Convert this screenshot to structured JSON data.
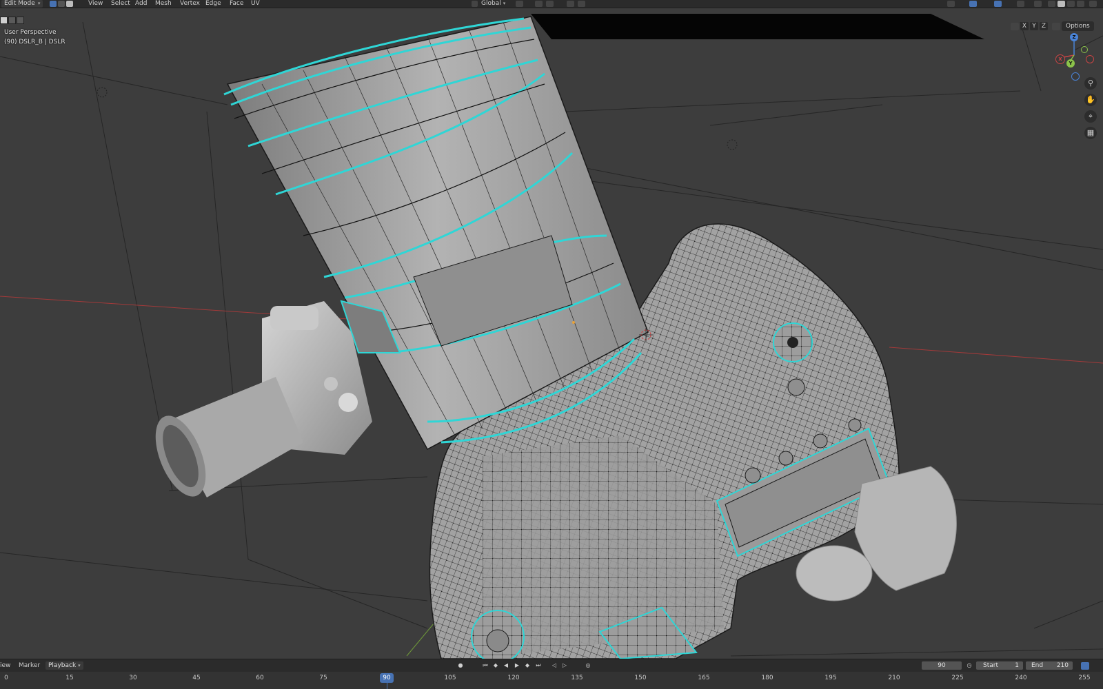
{
  "header": {
    "mode": "Edit Mode",
    "menus": [
      "View",
      "Select",
      "Add",
      "Mesh",
      "Vertex",
      "Edge",
      "Face",
      "UV"
    ],
    "transform_orientation": "Global",
    "axis_buttons": [
      "X",
      "Y",
      "Z"
    ],
    "options_label": "Options"
  },
  "viewport": {
    "view_name": "User Perspective",
    "object_info": "(90) DSLR_B | DSLR",
    "gizmo_axes": [
      "X",
      "Y",
      "Z"
    ],
    "nav_tools": [
      "zoom-icon",
      "hand-pan-icon",
      "camera-view-icon",
      "grid-ortho-icon"
    ]
  },
  "timeline": {
    "menus": [
      "View",
      "Marker",
      "Playback"
    ],
    "current_frame": "90",
    "start_label": "Start",
    "start_value": "1",
    "end_label": "End",
    "end_value": "210",
    "ruler": [
      "0",
      "15",
      "30",
      "45",
      "60",
      "75",
      "90",
      "105",
      "120",
      "135",
      "150",
      "165",
      "180",
      "195",
      "210",
      "225",
      "240",
      "255"
    ]
  },
  "colors": {
    "accent": "#4772b3",
    "selected_edges": "#2fd6d6",
    "mesh_surface": "#9a9a9a",
    "x_axis": "#c94545",
    "y_axis": "#8bc34a",
    "z_axis": "#4a84d8"
  }
}
